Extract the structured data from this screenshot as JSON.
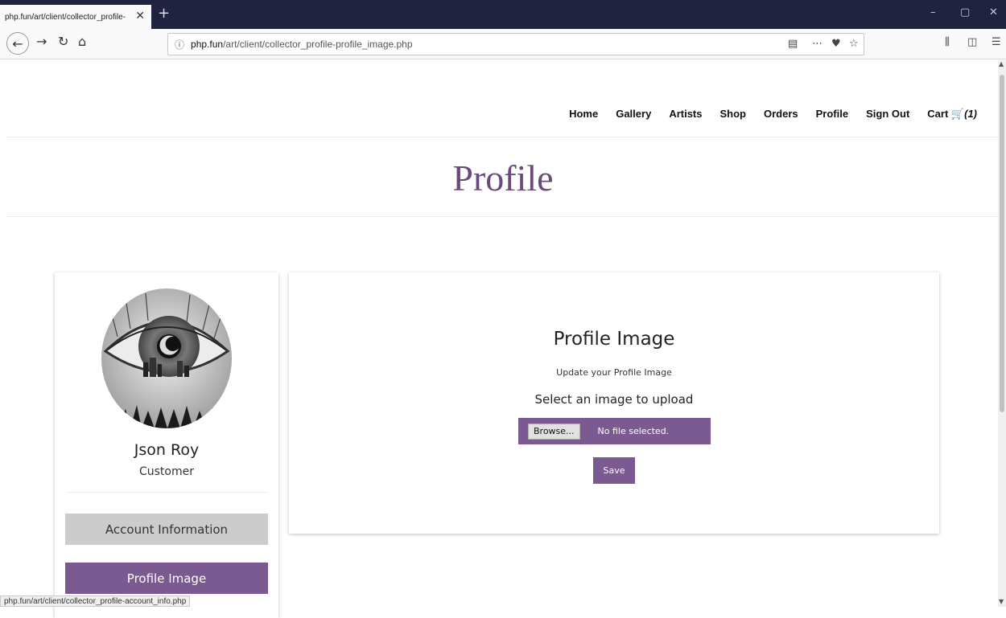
{
  "browser": {
    "tab_title": "php.fun/art/client/collector_profile-",
    "tab_close": "✕",
    "new_tab": "+",
    "url_host": "php.fun",
    "url_path": "/art/client/collector_profile-profile_image.php",
    "status_url": "php.fun/art/client/collector_profile-account_info.php"
  },
  "site_nav": {
    "items": [
      "Home",
      "Gallery",
      "Artists",
      "Shop",
      "Orders",
      "Profile",
      "Sign Out"
    ],
    "cart_label": "Cart",
    "cart_count": "(1)"
  },
  "page_title": "Profile",
  "sidebar": {
    "user_name": "Json Roy",
    "user_role": "Customer",
    "account_button": "Account Information",
    "image_button": "Profile Image"
  },
  "main": {
    "heading": "Profile Image",
    "subheading": "Update your Profile Image",
    "select_label": "Select an image to upload",
    "browse_button": "Browse...",
    "file_status": "No file selected.",
    "save_button": "Save"
  },
  "colors": {
    "accent": "#7a5a90",
    "title": "#6a4a7e",
    "chrome_dark": "#202340"
  }
}
